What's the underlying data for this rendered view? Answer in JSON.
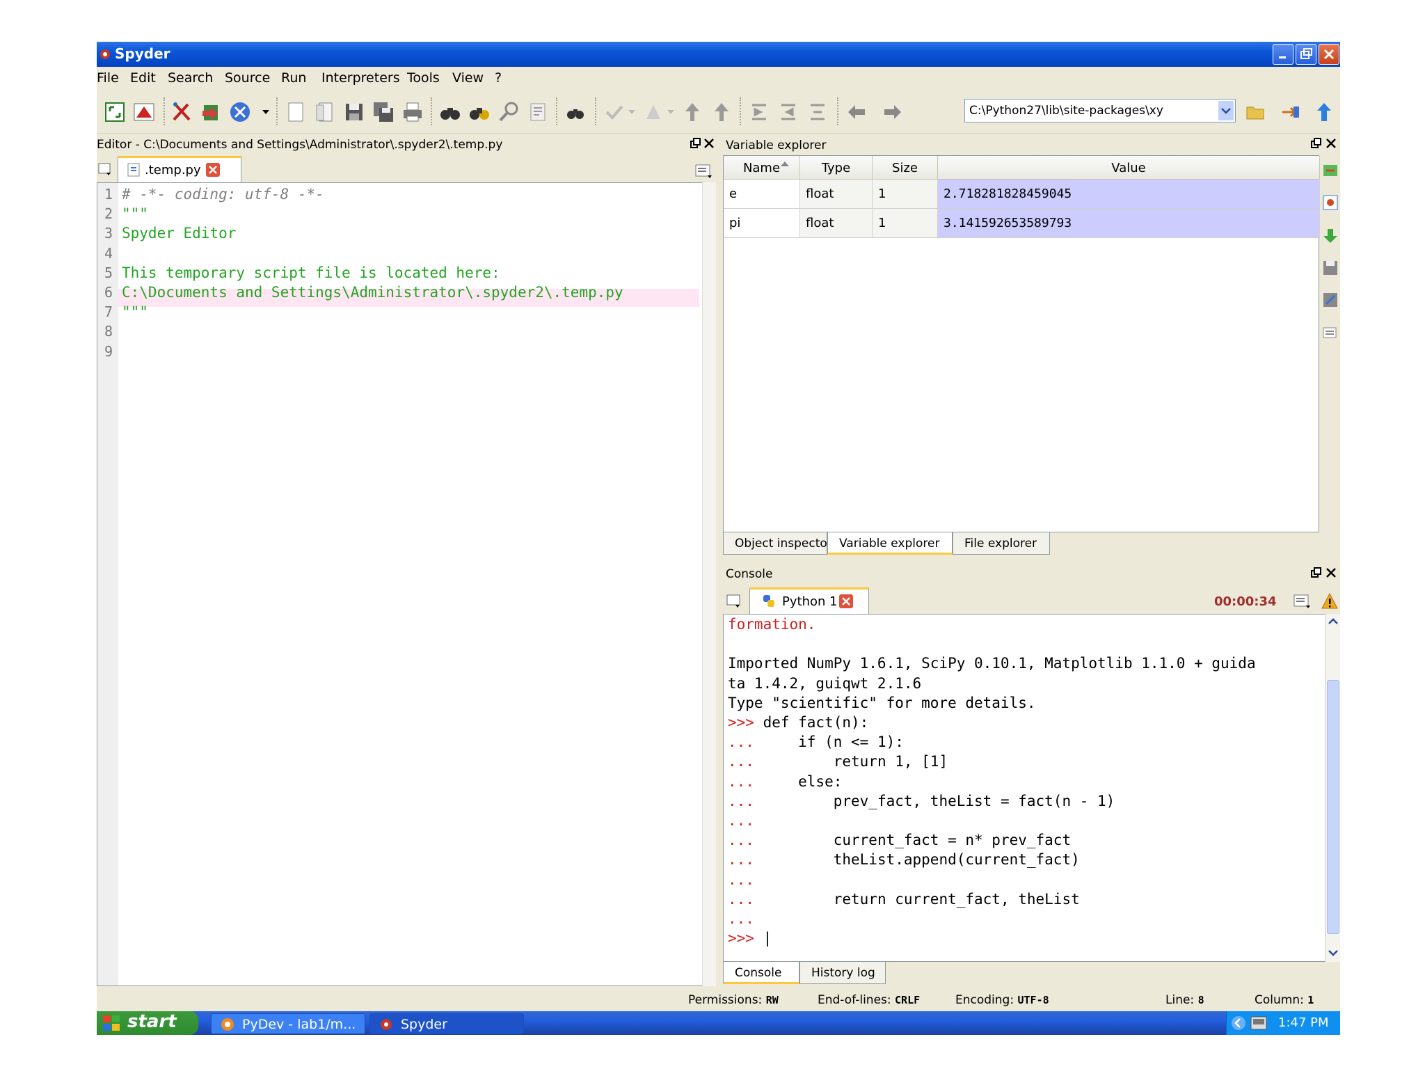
{
  "window": {
    "title": "Spyder"
  },
  "menu": [
    "File",
    "Edit",
    "Search",
    "Source",
    "Run",
    "Interpreters",
    "Tools",
    "View",
    "?"
  ],
  "toolbar": {
    "path": "C:\\Python27\\lib\\site-packages\\xy"
  },
  "editor": {
    "header": "Editor - C:\\Documents and Settings\\Administrator\\.spyder2\\.temp.py",
    "tab": ".temp.py",
    "line_numbers": [
      "1",
      "2",
      "3",
      "4",
      "5",
      "6",
      "7",
      "8",
      "9"
    ],
    "lines": [
      "# -*- coding: utf-8 -*-",
      "\"\"\"",
      "Spyder Editor",
      "",
      "This temporary script file is located here:",
      "C:\\Documents and Settings\\Administrator\\.spyder2\\.temp.py",
      "\"\"\"",
      "",
      ""
    ]
  },
  "variable_explorer": {
    "title": "Variable explorer",
    "columns": [
      "Name",
      "Type",
      "Size",
      "Value"
    ],
    "rows": [
      {
        "name": "e",
        "type": "float",
        "size": "1",
        "value": "2.718281828459045"
      },
      {
        "name": "pi",
        "type": "float",
        "size": "1",
        "value": "3.141592653589793"
      }
    ],
    "tabs": [
      "Object inspector",
      "Variable explorer",
      "File explorer"
    ]
  },
  "console": {
    "title": "Console",
    "tab": "Python 1",
    "elapsed": "00:00:34",
    "lines": [
      {
        "prefix": "",
        "text": "formation.",
        "kind": "err"
      },
      {
        "prefix": "",
        "text": "",
        "kind": "out"
      },
      {
        "prefix": "",
        "text": "Imported NumPy 1.6.1, SciPy 0.10.1, Matplotlib 1.1.0 + guida",
        "kind": "out"
      },
      {
        "prefix": "",
        "text": "ta 1.4.2, guiqwt 2.1.6",
        "kind": "out"
      },
      {
        "prefix": "",
        "text": "Type \"scientific\" for more details.",
        "kind": "out"
      },
      {
        "prefix": ">>> ",
        "text": "def fact(n):",
        "kind": "in"
      },
      {
        "prefix": "... ",
        "text": "    if (n <= 1):",
        "kind": "in"
      },
      {
        "prefix": "... ",
        "text": "        return 1, [1]",
        "kind": "in"
      },
      {
        "prefix": "... ",
        "text": "    else:",
        "kind": "in"
      },
      {
        "prefix": "... ",
        "text": "        prev_fact, theList = fact(n - 1)",
        "kind": "in"
      },
      {
        "prefix": "... ",
        "text": "",
        "kind": "in"
      },
      {
        "prefix": "... ",
        "text": "        current_fact = n* prev_fact",
        "kind": "in"
      },
      {
        "prefix": "... ",
        "text": "        theList.append(current_fact)",
        "kind": "in"
      },
      {
        "prefix": "... ",
        "text": "",
        "kind": "in"
      },
      {
        "prefix": "... ",
        "text": "        return current_fact, theList",
        "kind": "in"
      },
      {
        "prefix": "... ",
        "text": "",
        "kind": "in"
      },
      {
        "prefix": ">>> ",
        "text": "",
        "kind": "in"
      }
    ],
    "tabs": [
      "Console",
      "History log"
    ]
  },
  "status": {
    "permissions_label": "Permissions:",
    "permissions": "RW",
    "eol_label": "End-of-lines:",
    "eol": "CRLF",
    "encoding_label": "Encoding:",
    "encoding": "UTF-8",
    "line_label": "Line:",
    "line": "8",
    "column_label": "Column:",
    "column": "1"
  },
  "taskbar": {
    "start": "start",
    "tasks": [
      "PyDev - lab1/m...",
      "Spyder"
    ],
    "clock": "1:47 PM"
  },
  "colors": {
    "accent": "#ffc83c",
    "value_bg": "#ccccff",
    "titlebar": "#0a56d6"
  }
}
